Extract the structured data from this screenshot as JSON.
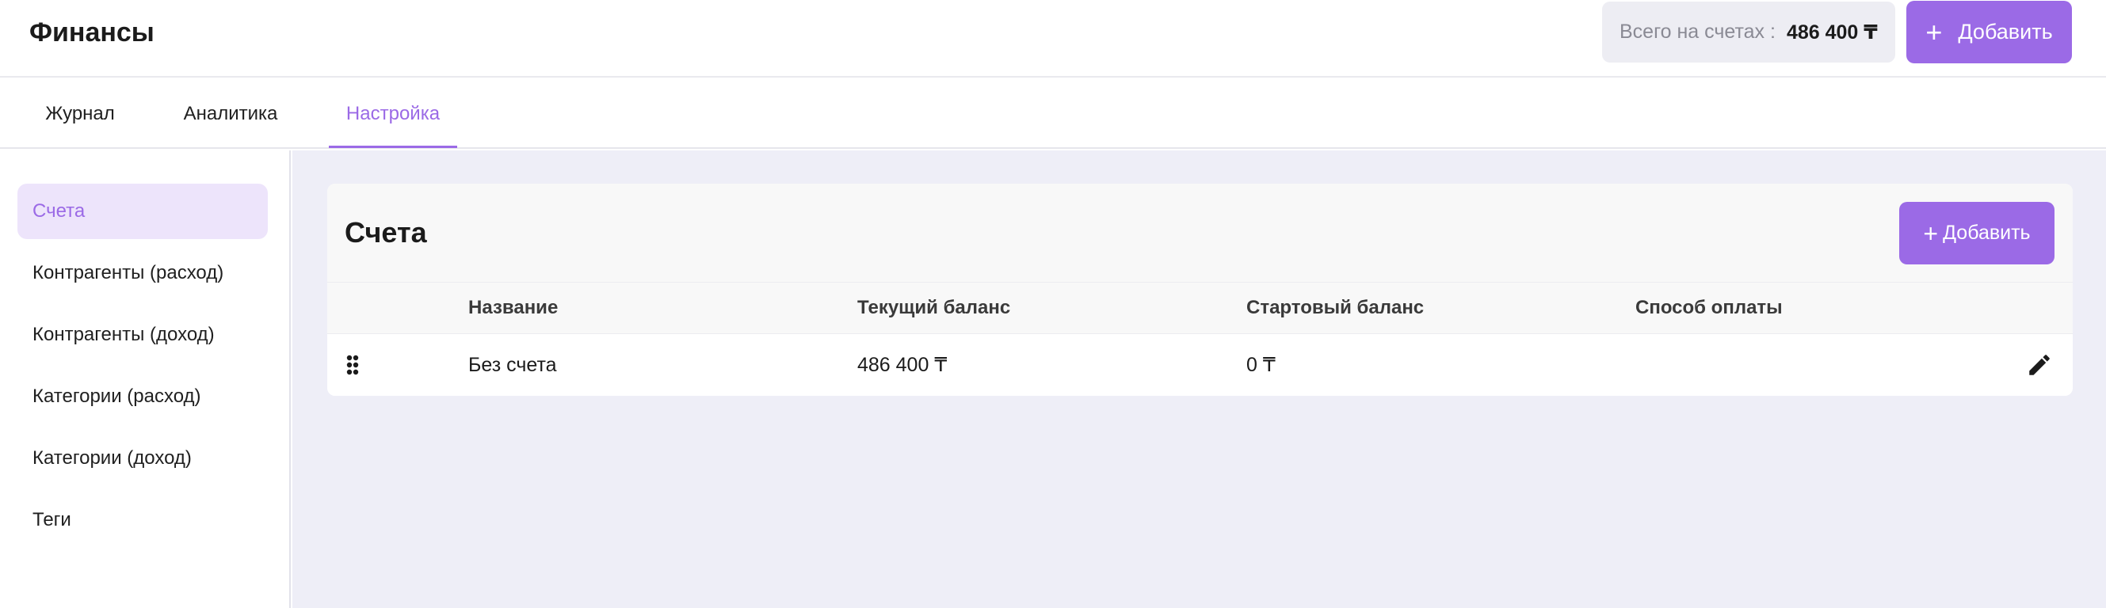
{
  "header": {
    "title": "Финансы",
    "total_label": "Всего на счетах :",
    "total_value": "486 400 ₸",
    "add_label": "Добавить",
    "add_icon": "plus-icon"
  },
  "tabs": [
    {
      "label": "Журнал",
      "active": false
    },
    {
      "label": "Аналитика",
      "active": false
    },
    {
      "label": "Настройка",
      "active": true
    }
  ],
  "sidebar": {
    "items": [
      {
        "label": "Счета",
        "active": true
      },
      {
        "label": "Контрагенты (расход)",
        "active": false
      },
      {
        "label": "Контрагенты (доход)",
        "active": false
      },
      {
        "label": "Категории (расход)",
        "active": false
      },
      {
        "label": "Категории (доход)",
        "active": false
      },
      {
        "label": "Теги",
        "active": false
      }
    ]
  },
  "accounts": {
    "title": "Счета",
    "add_label": "Добавить",
    "add_icon": "plus-icon",
    "columns": [
      "Название",
      "Текущий баланс",
      "Стартовый баланс",
      "Способ оплаты"
    ],
    "rows": [
      {
        "name": "Без счета",
        "current_balance": "486 400 ₸",
        "start_balance": "0 ₸",
        "payment_method": "",
        "drag_icon": "drag-handle-icon",
        "edit_icon": "pencil-icon"
      }
    ]
  },
  "colors": {
    "accent": "#9b6ae6",
    "accent_light": "#ede4fb",
    "main_bg": "#eeeef7",
    "total_bg": "#ededf3"
  }
}
